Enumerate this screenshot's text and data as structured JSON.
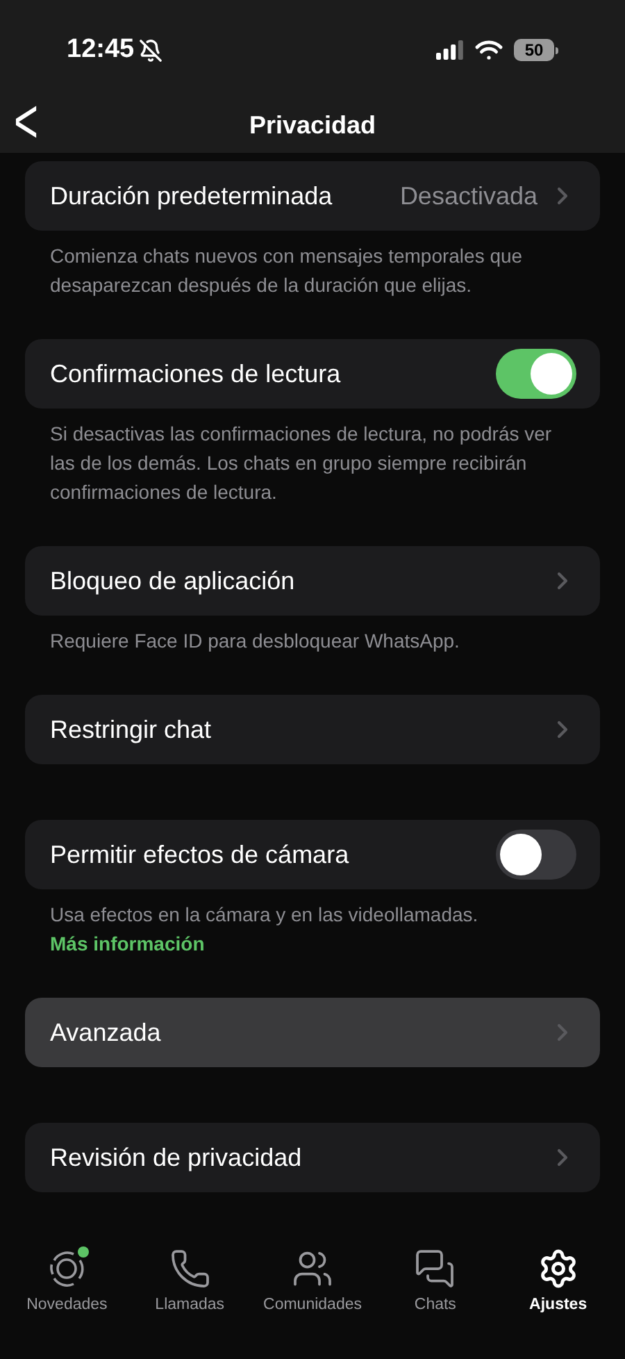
{
  "status_bar": {
    "time": "12:45",
    "battery": "50"
  },
  "header": {
    "back": "<",
    "title": "Privacidad"
  },
  "sections": [
    {
      "kind": "link",
      "label": "Duración predeterminada",
      "value": "Desactivada",
      "selected": false,
      "footnote": "Comienza chats nuevos con mensajes temporales que desaparezcan después de la duración que elijas."
    },
    {
      "kind": "toggle",
      "label": "Confirmaciones de lectura",
      "on": true,
      "selected": false,
      "footnote": "Si desactivas las confirmaciones de lectura, no podrás ver las de los demás. Los chats en grupo siempre recibirán confirmaciones de lectura."
    },
    {
      "kind": "link",
      "label": "Bloqueo de aplicación",
      "selected": false,
      "footnote": "Requiere Face ID para desbloquear WhatsApp."
    },
    {
      "kind": "link",
      "label": "Restringir chat",
      "selected": false
    },
    {
      "kind": "toggle",
      "label": "Permitir efectos de cámara",
      "on": false,
      "selected": false,
      "footnote": "Usa efectos en la cámara y en las videollamadas.",
      "footnote_link": "Más información"
    },
    {
      "kind": "link",
      "label": "Avanzada",
      "selected": true
    },
    {
      "kind": "link",
      "label": "Revisión de privacidad",
      "selected": false
    }
  ],
  "tab_bar": [
    {
      "kind": "updates",
      "label": "Novedades",
      "selected": false,
      "badge": true
    },
    {
      "kind": "calls",
      "label": "Llamadas",
      "selected": false,
      "badge": false
    },
    {
      "kind": "communities",
      "label": "Comunidades",
      "selected": false,
      "badge": false
    },
    {
      "kind": "chats",
      "label": "Chats",
      "selected": false,
      "badge": false
    },
    {
      "kind": "settings",
      "label": "Ajustes",
      "selected": true,
      "badge": false
    }
  ]
}
